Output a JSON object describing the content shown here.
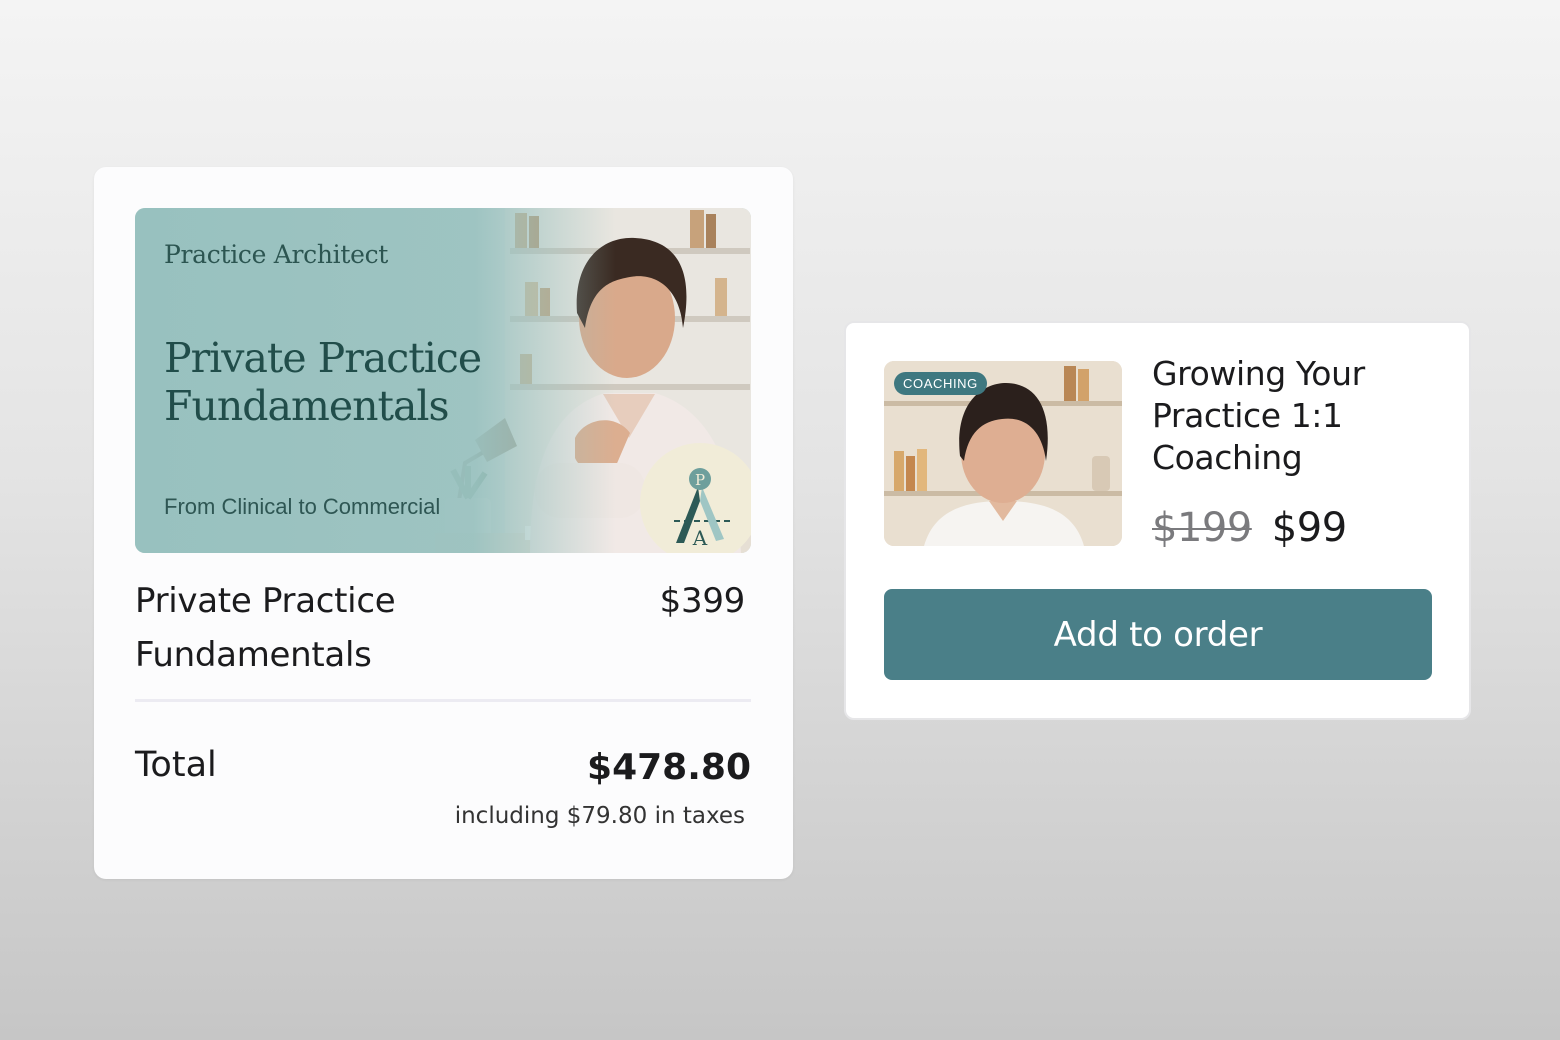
{
  "order": {
    "banner": {
      "brand": "Practice Architect",
      "title": "Private Practice Fundamentals",
      "subtitle": "From Clinical to Commercial",
      "logo_letters": [
        "P",
        "A"
      ]
    },
    "item": {
      "name": "Private Practice Fundamentals",
      "price": "$399"
    },
    "total": {
      "label": "Total",
      "value": "$478.80",
      "tax_note": "including $79.80 in taxes"
    }
  },
  "upsell": {
    "badge": "COACHING",
    "title": "Growing Your Practice 1:1 Coaching",
    "old_price": "$199",
    "new_price": "$99",
    "button_label": "Add to order"
  },
  "colors": {
    "accent": "#4a7f88",
    "banner_bg": "#98c1bf",
    "banner_text": "#214d4a"
  }
}
